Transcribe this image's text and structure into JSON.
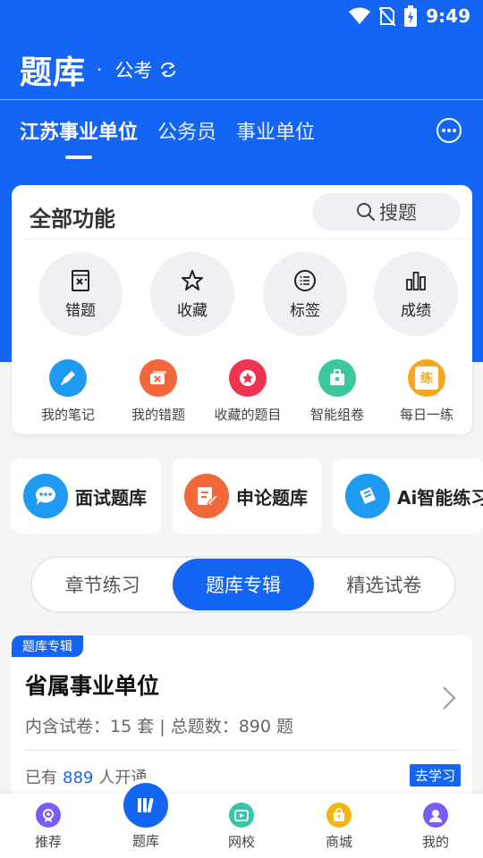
{
  "status_bar": {
    "time": "9:49"
  },
  "header": {
    "title": "题库",
    "dot": "·",
    "exam_type": "公考"
  },
  "tabs": [
    {
      "label": "江苏事业单位",
      "active": true
    },
    {
      "label": "公务员",
      "active": false
    },
    {
      "label": "事业单位",
      "active": false
    }
  ],
  "functions": {
    "heading": "全部功能",
    "search_label": "搜题",
    "primary": [
      {
        "label": "错题",
        "icon": "mistake-book-icon"
      },
      {
        "label": "收藏",
        "icon": "star-icon"
      },
      {
        "label": "标签",
        "icon": "list-icon"
      },
      {
        "label": "成绩",
        "icon": "bar-chart-icon"
      }
    ],
    "secondary": [
      {
        "label": "我的笔记",
        "icon": "pencil-icon",
        "color": "#1e9af3"
      },
      {
        "label": "我的错题",
        "icon": "wrong-card-icon",
        "color": "#f2683a"
      },
      {
        "label": "收藏的题目",
        "icon": "star-badge-icon",
        "color": "#ee3450"
      },
      {
        "label": "智能组卷",
        "icon": "briefcase-icon",
        "color": "#3cc79e"
      },
      {
        "label": "每日一练",
        "icon": "practice-icon",
        "color": "#f5a623",
        "glyph": "练"
      }
    ]
  },
  "banks": [
    {
      "label": "面试题库",
      "icon": "chat-bubble-icon",
      "color": "#1e9af3"
    },
    {
      "label": "申论题库",
      "icon": "essay-icon",
      "color": "#f2683a"
    },
    {
      "label": "Ai智能练习",
      "icon": "ai-practice-icon",
      "color": "#1e9af3"
    }
  ],
  "segments": [
    {
      "label": "章节练习",
      "active": false
    },
    {
      "label": "题库专辑",
      "active": true
    },
    {
      "label": "精选试卷",
      "active": false
    }
  ],
  "album": {
    "tag": "题库专辑",
    "name": "省属事业单位",
    "meta": "内含试卷：15 套 | 总题数：890 题",
    "count_prefix": "已有",
    "count_value": "889",
    "count_suffix": "人开通",
    "action": "去学习"
  },
  "bottom_nav": [
    {
      "label": "推荐",
      "icon": "recommend-icon",
      "color": "#7d5bf6"
    },
    {
      "label": "题库",
      "icon": "question-bank-icon",
      "color": "#1565f5",
      "active": true
    },
    {
      "label": "网校",
      "icon": "tv-icon",
      "color": "#39c6a8"
    },
    {
      "label": "商城",
      "icon": "shop-bag-icon",
      "color": "#f5b511"
    },
    {
      "label": "我的",
      "icon": "profile-icon",
      "color": "#7d5bf6"
    }
  ],
  "colors": {
    "primary": "#1565f5",
    "background": "#f4f5f7"
  }
}
